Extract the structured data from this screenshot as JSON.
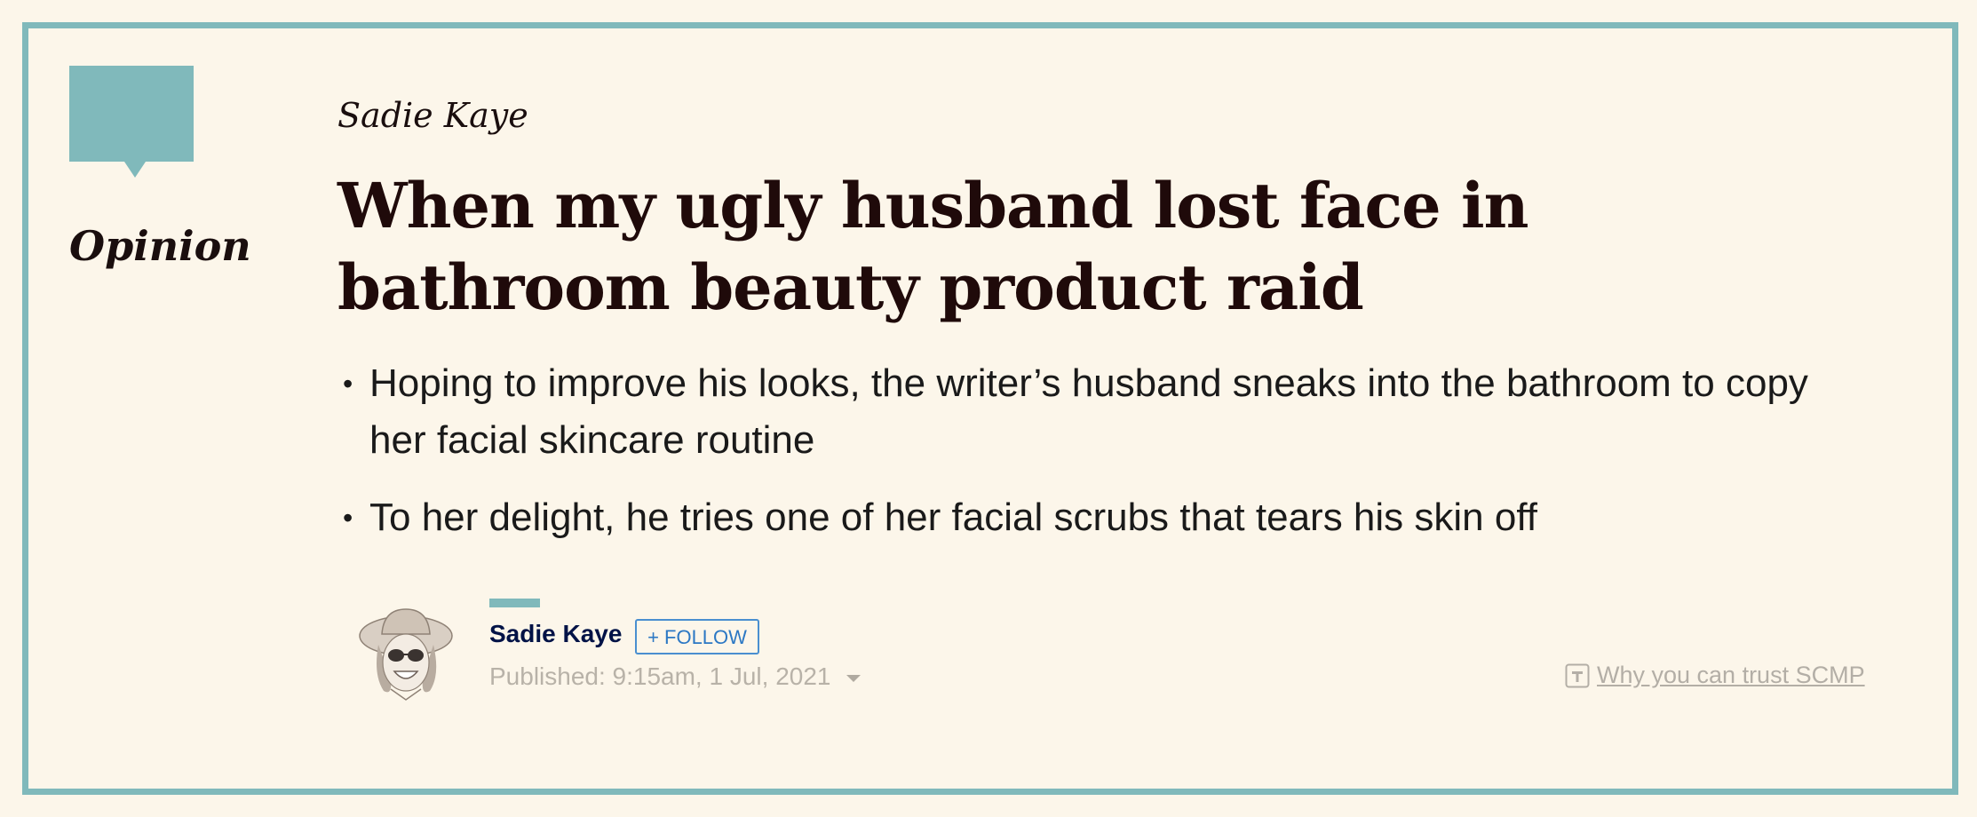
{
  "badge": {
    "label": "Opinion",
    "color": "#80b9bb"
  },
  "article": {
    "kicker": "Sadie Kaye",
    "headline": "When my ugly husband lost face in bathroom beauty product raid",
    "summary": [
      "Hoping to improve his looks, the writer’s husband sneaks into the bathroom to copy her facial skincare routine",
      "To her delight, he tries one of her facial scrubs that tears his skin off"
    ]
  },
  "byline": {
    "author": "Sadie Kaye",
    "follow_label": "+ FOLLOW",
    "published": "Published: 9:15am, 1 Jul, 2021",
    "avatar_icon": "author-illustration"
  },
  "trust": {
    "icon": "trust-t-icon",
    "label": "Why you can trust SCMP"
  },
  "colors": {
    "background": "#fcf6ea",
    "accent": "#80b9bb",
    "headline": "#1f0a0a",
    "follow": "#2c78c4",
    "author": "#001246"
  }
}
